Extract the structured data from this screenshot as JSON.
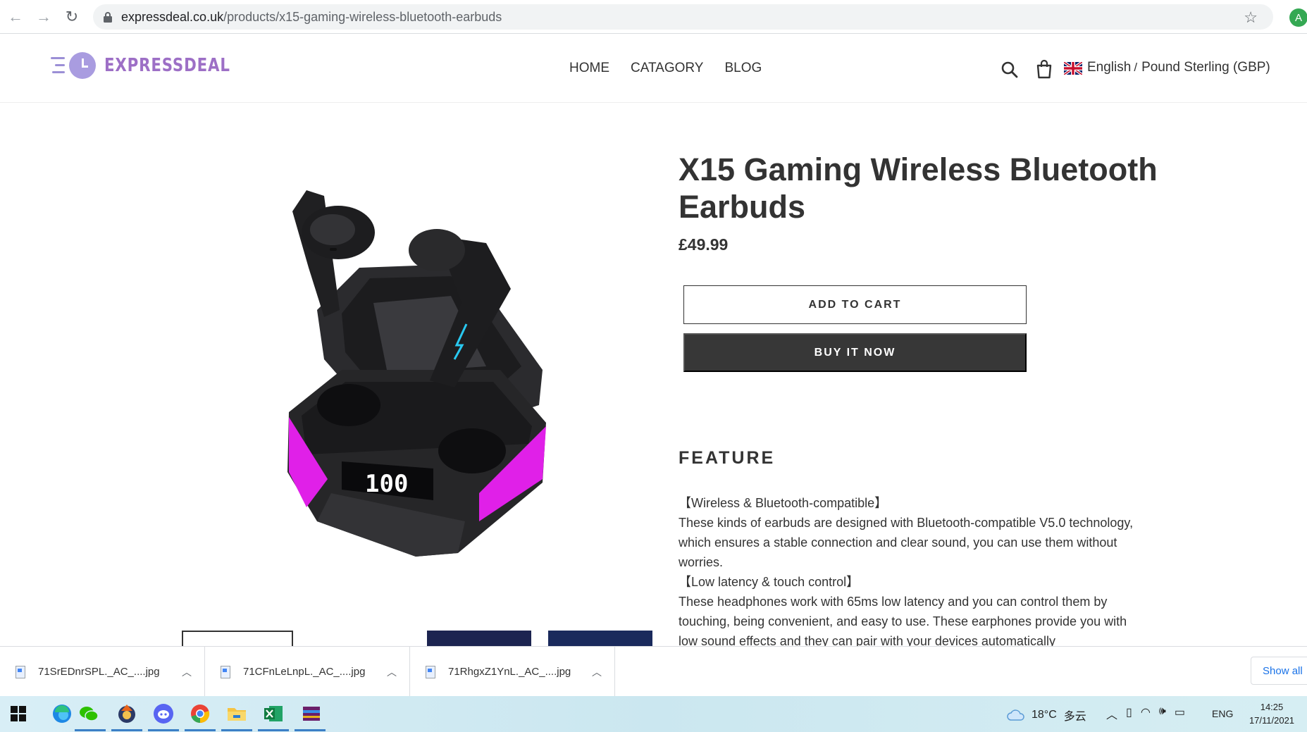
{
  "browser": {
    "url_domain": "expressdeal.co.uk",
    "url_path": "/products/x15-gaming-wireless-bluetooth-earbuds",
    "profile_initial": "A"
  },
  "header": {
    "logo_text": "EXPRESSDEAL",
    "nav": [
      "HOME",
      "CATAGORY",
      "BLOG"
    ],
    "language": "English",
    "currency": "Pound Sterling (GBP)"
  },
  "product": {
    "title": "X15 Gaming Wireless Bluetooth Earbuds",
    "price": "£49.99",
    "add_to_cart_label": "ADD TO CART",
    "buy_now_label": "BUY IT NOW",
    "case_display": "100",
    "feature_heading": "FEATURE",
    "feature_lines": [
      "【Wireless & Bluetooth-compatible】",
      "These kinds of earbuds are designed with Bluetooth-compatible V5.0 technology, which ensures a stable connection and clear sound, you can use them without worries.",
      "【Low latency & touch control】",
      "These headphones work with 65ms low latency and you can control them by touching, being convenient, and easy to use. These earphones provide you with low sound effects and they can pair with your devices automatically"
    ]
  },
  "downloads": {
    "files": [
      "71SrEDnrSPL._AC_....jpg",
      "71CFnLeLnpL._AC_....jpg",
      "71RhgxZ1YnL._AC_....jpg"
    ],
    "show_all_label": "Show all"
  },
  "taskbar": {
    "weather_temp": "18°C",
    "weather_desc": "多云",
    "language": "ENG",
    "time": "14:25",
    "date": "17/11/2021"
  },
  "colors": {
    "accent_purple": "#9d6fc6",
    "case_magenta": "#e020e8",
    "buy_button": "#373737"
  }
}
